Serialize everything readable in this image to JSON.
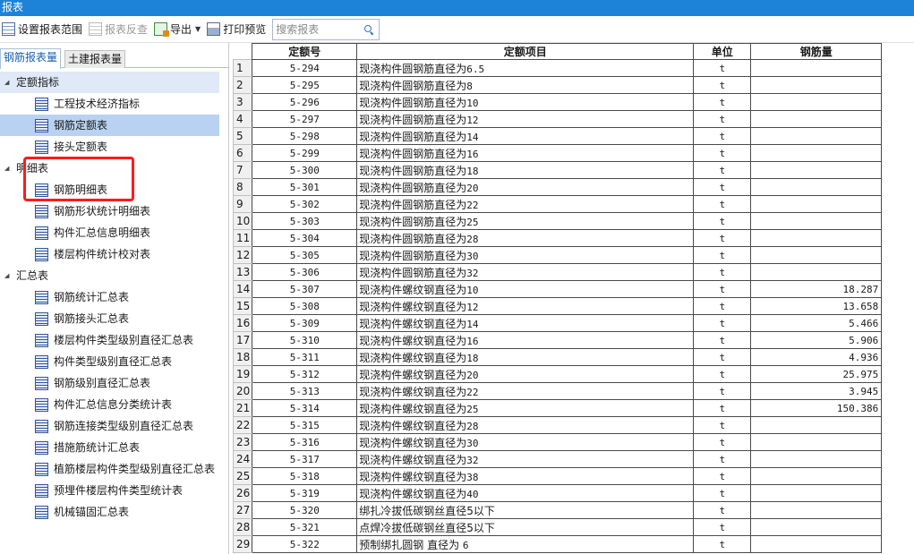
{
  "window": {
    "title": "报表"
  },
  "toolbar": {
    "set_range_label": "设置报表范围",
    "reverse_check_label": "报表反查",
    "export_label": "导出",
    "print_preview_label": "打印预览",
    "search_placeholder": "搜索报表"
  },
  "left_tabs": [
    {
      "label": "钢筋报表量",
      "active": true
    },
    {
      "label": "土建报表量",
      "active": false
    }
  ],
  "tree": {
    "groups": [
      {
        "label": "定额指标",
        "items": [
          "工程技术经济指标",
          "钢筋定额表",
          "接头定额表"
        ]
      },
      {
        "label": "明细表",
        "items": [
          "钢筋明细表",
          "钢筋形状统计明细表",
          "构件汇总信息明细表",
          "楼层构件统计校对表"
        ]
      },
      {
        "label": "汇总表",
        "items": [
          "钢筋统计汇总表",
          "钢筋接头汇总表",
          "楼层构件类型级别直径汇总表",
          "构件类型级别直径汇总表",
          "钢筋级别直径汇总表",
          "构件汇总信息分类统计表",
          "钢筋连接类型级别直径汇总表",
          "措施筋统计汇总表",
          "植筋楼层构件类型级别直径汇总表",
          "预埋件楼层构件类型统计表",
          "机械锚固汇总表"
        ]
      }
    ],
    "selected_item": "钢筋定额表"
  },
  "table": {
    "columns": [
      "定额号",
      "定额项目",
      "单位",
      "钢筋量"
    ],
    "rows": [
      {
        "num": "1",
        "code": "5-294",
        "item_prefix": "现浇构件圆钢筋直径为",
        "item_size": "6.5",
        "unit": "t",
        "amount": ""
      },
      {
        "num": "2",
        "code": "5-295",
        "item_prefix": "现浇构件圆钢筋直径为",
        "item_size": "8",
        "unit": "t",
        "amount": ""
      },
      {
        "num": "3",
        "code": "5-296",
        "item_prefix": "现浇构件圆钢筋直径为",
        "item_size": "10",
        "unit": "t",
        "amount": ""
      },
      {
        "num": "4",
        "code": "5-297",
        "item_prefix": "现浇构件圆钢筋直径为",
        "item_size": "12",
        "unit": "t",
        "amount": ""
      },
      {
        "num": "5",
        "code": "5-298",
        "item_prefix": "现浇构件圆钢筋直径为",
        "item_size": "14",
        "unit": "t",
        "amount": ""
      },
      {
        "num": "6",
        "code": "5-299",
        "item_prefix": "现浇构件圆钢筋直径为",
        "item_size": "16",
        "unit": "t",
        "amount": ""
      },
      {
        "num": "7",
        "code": "5-300",
        "item_prefix": "现浇构件圆钢筋直径为",
        "item_size": "18",
        "unit": "t",
        "amount": ""
      },
      {
        "num": "8",
        "code": "5-301",
        "item_prefix": "现浇构件圆钢筋直径为",
        "item_size": "20",
        "unit": "t",
        "amount": ""
      },
      {
        "num": "9",
        "code": "5-302",
        "item_prefix": "现浇构件圆钢筋直径为",
        "item_size": "22",
        "unit": "t",
        "amount": ""
      },
      {
        "num": "10",
        "code": "5-303",
        "item_prefix": "现浇构件圆钢筋直径为",
        "item_size": "25",
        "unit": "t",
        "amount": ""
      },
      {
        "num": "11",
        "code": "5-304",
        "item_prefix": "现浇构件圆钢筋直径为",
        "item_size": "28",
        "unit": "t",
        "amount": ""
      },
      {
        "num": "12",
        "code": "5-305",
        "item_prefix": "现浇构件圆钢筋直径为",
        "item_size": "30",
        "unit": "t",
        "amount": ""
      },
      {
        "num": "13",
        "code": "5-306",
        "item_prefix": "现浇构件圆钢筋直径为",
        "item_size": "32",
        "unit": "t",
        "amount": ""
      },
      {
        "num": "14",
        "code": "5-307",
        "item_prefix": "现浇构件螺纹钢直径为",
        "item_size": "10",
        "unit": "t",
        "amount": "18.287"
      },
      {
        "num": "15",
        "code": "5-308",
        "item_prefix": "现浇构件螺纹钢直径为",
        "item_size": "12",
        "unit": "t",
        "amount": "13.658"
      },
      {
        "num": "16",
        "code": "5-309",
        "item_prefix": "现浇构件螺纹钢直径为",
        "item_size": "14",
        "unit": "t",
        "amount": "5.466"
      },
      {
        "num": "17",
        "code": "5-310",
        "item_prefix": "现浇构件螺纹钢直径为",
        "item_size": "16",
        "unit": "t",
        "amount": "5.906"
      },
      {
        "num": "18",
        "code": "5-311",
        "item_prefix": "现浇构件螺纹钢直径为",
        "item_size": "18",
        "unit": "t",
        "amount": "4.936"
      },
      {
        "num": "19",
        "code": "5-312",
        "item_prefix": "现浇构件螺纹钢直径为",
        "item_size": "20",
        "unit": "t",
        "amount": "25.975"
      },
      {
        "num": "20",
        "code": "5-313",
        "item_prefix": "现浇构件螺纹钢直径为",
        "item_size": "22",
        "unit": "t",
        "amount": "3.945"
      },
      {
        "num": "21",
        "code": "5-314",
        "item_prefix": "现浇构件螺纹钢直径为",
        "item_size": "25",
        "unit": "t",
        "amount": "150.386"
      },
      {
        "num": "22",
        "code": "5-315",
        "item_prefix": "现浇构件螺纹钢直径为",
        "item_size": "28",
        "unit": "t",
        "amount": ""
      },
      {
        "num": "23",
        "code": "5-316",
        "item_prefix": "现浇构件螺纹钢直径为",
        "item_size": "30",
        "unit": "t",
        "amount": ""
      },
      {
        "num": "24",
        "code": "5-317",
        "item_prefix": "现浇构件螺纹钢直径为",
        "item_size": "32",
        "unit": "t",
        "amount": ""
      },
      {
        "num": "25",
        "code": "5-318",
        "item_prefix": "现浇构件螺纹钢直径为",
        "item_size": "38",
        "unit": "t",
        "amount": ""
      },
      {
        "num": "26",
        "code": "5-319",
        "item_prefix": "现浇构件螺纹钢直径为",
        "item_size": "40",
        "unit": "t",
        "amount": ""
      },
      {
        "num": "27",
        "code": "5-320",
        "item_prefix": "绑扎冷拔低碳钢丝直径5以下",
        "item_size": "",
        "unit": "t",
        "amount": ""
      },
      {
        "num": "28",
        "code": "5-321",
        "item_prefix": "点焊冷拔低碳钢丝直径5以下",
        "item_size": "",
        "unit": "t",
        "amount": ""
      },
      {
        "num": "29",
        "code": "5-322",
        "item_prefix": "预制绑扎圆钢 直径为 ",
        "item_size": "6",
        "unit": "t",
        "amount": ""
      }
    ]
  },
  "colors": {
    "titlebar": "#1c83d8",
    "selection": "#b9d2f1",
    "highlight_outline": "#ff1a1a"
  }
}
